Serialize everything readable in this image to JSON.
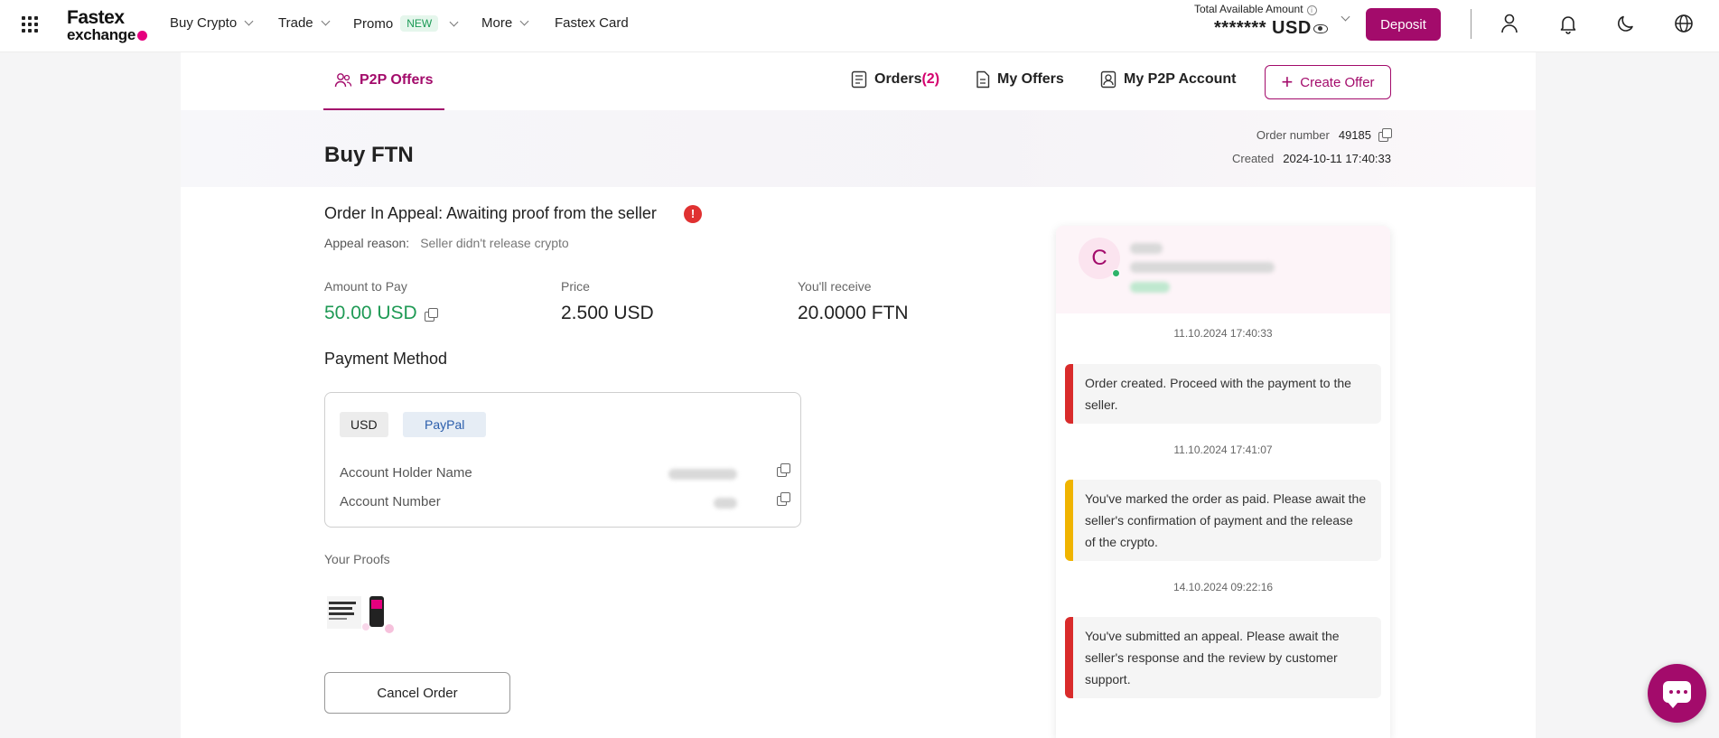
{
  "header": {
    "logo_line1": "Fastex",
    "logo_line2": "exchange",
    "nav": [
      {
        "label": "Buy Crypto"
      },
      {
        "label": "Trade"
      },
      {
        "label": "Promo",
        "badge": "NEW"
      },
      {
        "label": "More"
      },
      {
        "label": "Fastex Card"
      }
    ],
    "total_label": "Total Available Amount",
    "total_value": "******* USD",
    "deposit_label": "Deposit",
    "icons": [
      "apps-icon",
      "user-icon",
      "bell-icon",
      "moon-icon",
      "globe-icon"
    ]
  },
  "tabs": {
    "p2p_offers": "P2P Offers",
    "orders": "Orders",
    "orders_count": "(2)",
    "my_offers": "My Offers",
    "my_account": "My P2P Account",
    "create_offer": "Create Offer"
  },
  "order": {
    "title": "Buy FTN",
    "number_label": "Order number",
    "number": "49185",
    "created_label": "Created",
    "created": "2024-10-11 17:40:33",
    "status": "Order In Appeal: Awaiting proof from the seller",
    "alert_glyph": "!",
    "appeal_label": "Appeal reason:",
    "appeal_reason": "Seller didn't release crypto",
    "amount_label": "Amount to Pay",
    "amount": "50.00 USD",
    "price_label": "Price",
    "price": "2.500 USD",
    "receive_label": "You'll receive",
    "receive": "20.0000 FTN",
    "payment_method_label": "Payment Method",
    "currency_chip": "USD",
    "method_chip": "PayPal",
    "holder_label": "Account Holder Name",
    "account_label": "Account Number",
    "proofs_label": "Your Proofs",
    "cancel_label": "Cancel Order"
  },
  "chat": {
    "avatar_letter": "C",
    "events": [
      {
        "time": "11.10.2024 17:40:33",
        "text": "Order created. Proceed with the payment to the seller.",
        "color": "#d92b2b"
      },
      {
        "time": "11.10.2024 17:41:07",
        "text": "You've marked the order as paid. Please await the seller's confirmation of payment and the release of the crypto.",
        "color": "#f0b400"
      },
      {
        "time": "14.10.2024 09:22:16",
        "text": "You've submitted an appeal. Please await the seller's response and the review by customer support.",
        "color": "#d92b2b"
      }
    ]
  },
  "colors": {
    "brand": "#a30b6b",
    "accent_pink": "#e6007e",
    "green": "#1f9a55",
    "alert_red": "#e03131"
  }
}
